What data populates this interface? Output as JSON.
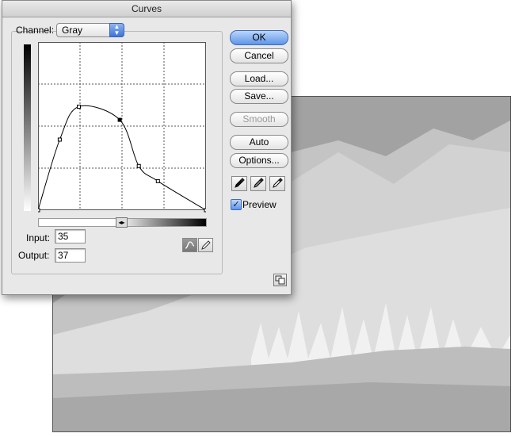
{
  "dialog": {
    "title": "Curves",
    "channel_label": "Channel:",
    "channel_value": "Gray",
    "input_label": "Input:",
    "input_value": "35",
    "output_label": "Output:",
    "output_value": "37",
    "preview_label": "Preview",
    "preview_checked": true
  },
  "buttons": {
    "ok": "OK",
    "cancel": "Cancel",
    "load": "Load...",
    "save": "Save...",
    "smooth": "Smooth",
    "auto": "Auto",
    "options": "Options..."
  },
  "curve": {
    "range": [
      0,
      255
    ],
    "points": [
      [
        0,
        0
      ],
      [
        33,
        107
      ],
      [
        62,
        157
      ],
      [
        124,
        137
      ],
      [
        153,
        67
      ],
      [
        182,
        44
      ],
      [
        255,
        0
      ]
    ],
    "selected_point_index": 3
  },
  "colors": {
    "accent": "#5d95e9",
    "dialog_bg": "#e8e8e8"
  },
  "icons": [
    "eyedropper-black-icon",
    "eyedropper-gray-icon",
    "eyedropper-white-icon",
    "curve-tool-icon",
    "pencil-tool-icon",
    "resize-icon"
  ]
}
